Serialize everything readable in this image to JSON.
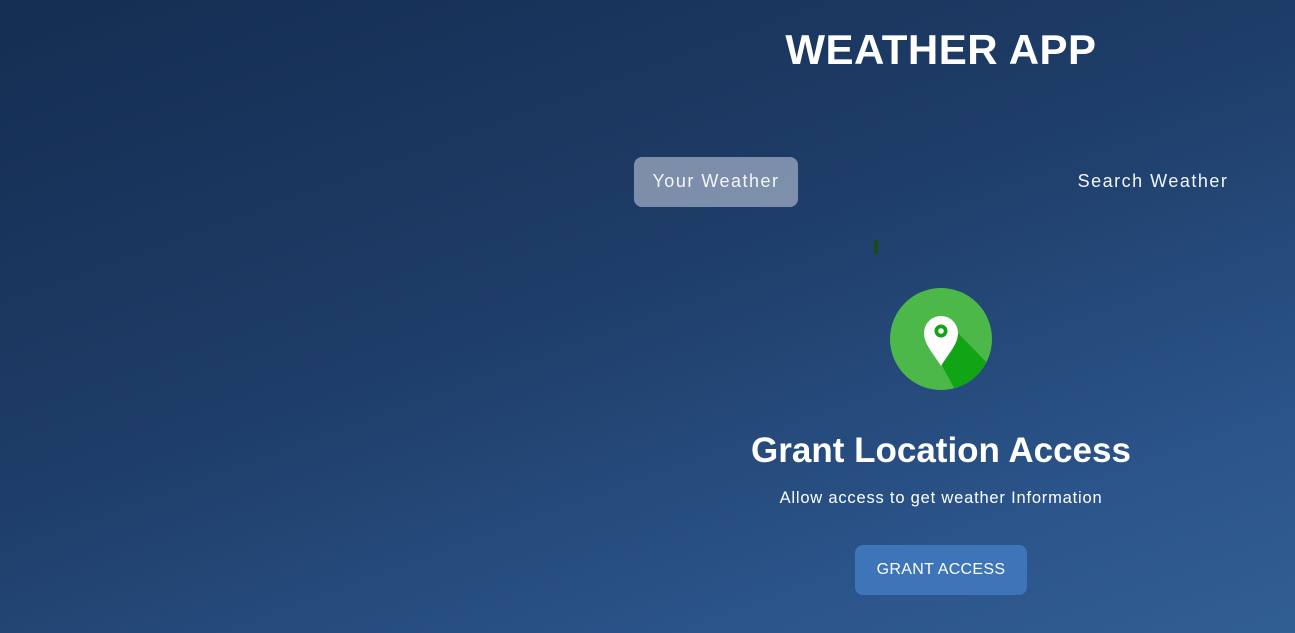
{
  "app": {
    "title": "WEATHER APP"
  },
  "tabs": [
    {
      "label": "Your Weather",
      "active": true
    },
    {
      "label": "Search Weather",
      "active": false
    }
  ],
  "grant_location": {
    "icon": "location-pin-icon",
    "icon_colors": {
      "circle": "#4db84a",
      "shadow": "#11a515",
      "pin": "#ffffff"
    },
    "heading": "Grant Location Access",
    "subtext": "Allow access to get weather Information",
    "button_label": "GRANT ACCESS"
  },
  "colors": {
    "background_top": "#142d52",
    "background_bottom": "#315e93",
    "active_tab_bg": "rgba(219,226,239,0.5)",
    "button_bg": "#3e74b8"
  }
}
